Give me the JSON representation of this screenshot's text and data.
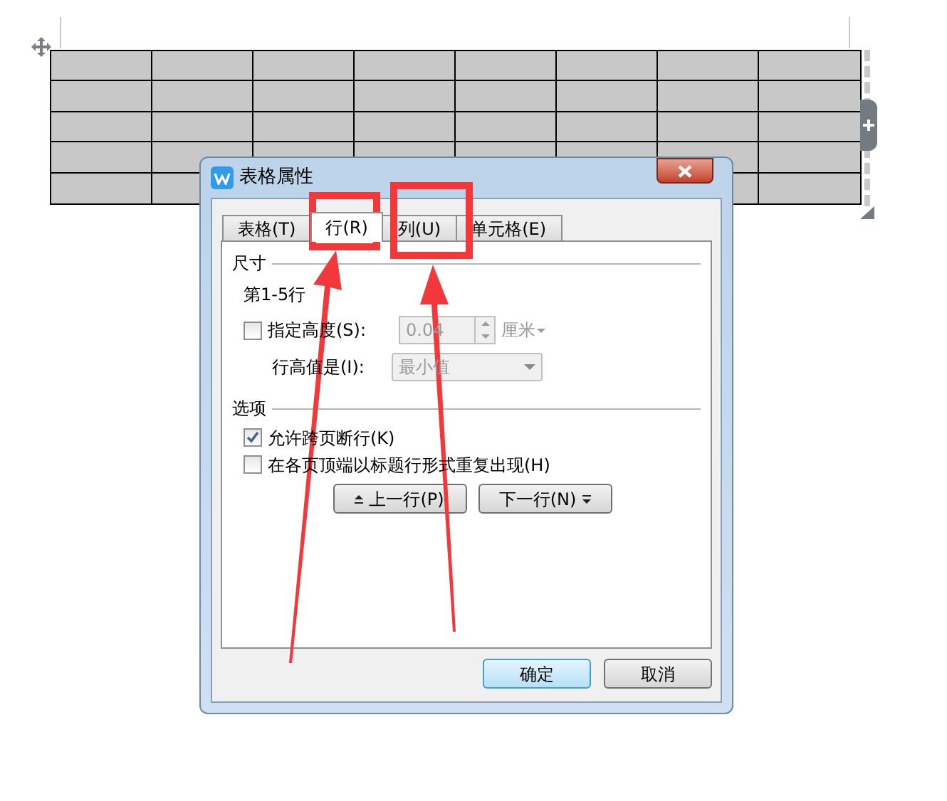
{
  "dialog": {
    "title": "表格属性",
    "tabs": [
      {
        "label": "表格(T)",
        "selected": false
      },
      {
        "label": "行(R)",
        "selected": true
      },
      {
        "label": "列(U)",
        "selected": false
      },
      {
        "label": "单元格(E)",
        "selected": false
      }
    ],
    "size_section": {
      "title": "尺寸",
      "rows_label": "第1-5行",
      "height": {
        "checked": false,
        "label": "指定高度(S):",
        "value": "0.04",
        "unit": "厘米"
      },
      "row_height_label": "行高值是(I):",
      "row_height_value": "最小值"
    },
    "options_section": {
      "title": "选项",
      "options": [
        {
          "label": "允许跨页断行(K)",
          "checked": true
        },
        {
          "label": "在各页顶端以标题行形式重复出现(H)",
          "checked": false
        }
      ]
    },
    "nav_buttons": [
      {
        "label": "上一行(P)",
        "kind": "prev"
      },
      {
        "label": "下一行(N)",
        "kind": "next"
      }
    ],
    "buttons": [
      {
        "label": "确定",
        "default": true
      },
      {
        "label": "取消",
        "default": false
      }
    ]
  }
}
